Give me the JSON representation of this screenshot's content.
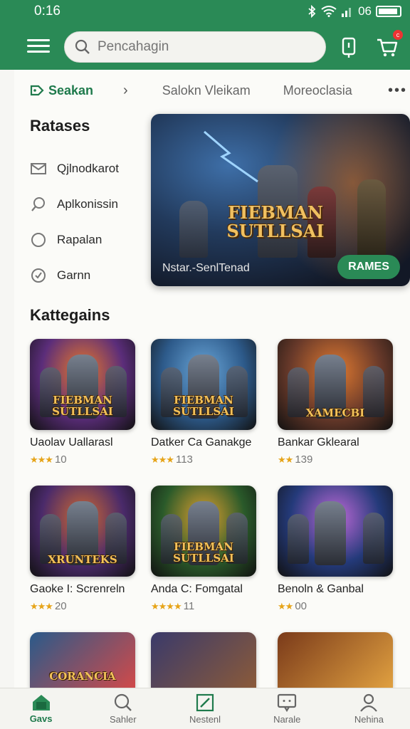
{
  "status": {
    "time": "0:16",
    "battery": "06"
  },
  "header": {
    "search_placeholder": "Pencahagin",
    "cart_badge": "c"
  },
  "breadcrumb": {
    "active": "Seakan",
    "link2": "Salokn Vleikam",
    "link3": "Moreoclasia",
    "more": "•••"
  },
  "sidebar": {
    "title": "Ratases",
    "items": [
      {
        "label": "Qjlnodkarot",
        "icon": "mail-icon"
      },
      {
        "label": "Aplkonissin",
        "icon": "search-icon"
      },
      {
        "label": "Rapalan",
        "icon": "circle-icon"
      },
      {
        "label": "Garnn",
        "icon": "check-circle-icon"
      }
    ]
  },
  "hero": {
    "logo_line1": "FIEBMAN",
    "logo_line2": "SUTLLSAI",
    "caption": "Nstar.-SenlTenad",
    "cta": "RAMES"
  },
  "categories": {
    "title": "Kattegains",
    "items": [
      {
        "name": "Uaolav Uallarasl",
        "rating": "10",
        "stars": "★★★",
        "logo": "FIEBMAN SUTLLSAI",
        "bg": "#5b2d7a",
        "accent": "#e8782a"
      },
      {
        "name": "Datker Ca Ganakge",
        "rating": "113",
        "stars": "★★★",
        "logo": "FIEBMAN SUTLLSAI",
        "bg": "#2d5a8a",
        "accent": "#6aa6d8"
      },
      {
        "name": "Bankar Gklearal",
        "rating": "139",
        "stars": "★★",
        "logo": "XAMECBI",
        "bg": "#6a3a2a",
        "accent": "#e07a30"
      },
      {
        "name": "Gaoke I: Screnreln",
        "rating": "20",
        "stars": "★★★",
        "logo": "XRUNTEKS",
        "bg": "#4a2a6a",
        "accent": "#d06a30"
      },
      {
        "name": "Anda C: Fomgatal",
        "rating": "11",
        "stars": "★★★★",
        "logo": "FIEBMAN SUTLLSAI",
        "bg": "#2a5a2a",
        "accent": "#e0a030"
      },
      {
        "name": "Benoln & Ganbal",
        "rating": "00",
        "stars": "★★",
        "logo": "",
        "bg": "#243a7a",
        "accent": "#c06ad8"
      }
    ],
    "partial_logo": "CORANCIA"
  },
  "bottom_nav": [
    {
      "label": "Gavs",
      "icon": "home-icon"
    },
    {
      "label": "Sahler",
      "icon": "search-icon"
    },
    {
      "label": "Nestenl",
      "icon": "edit-icon"
    },
    {
      "label": "Narale",
      "icon": "message-icon"
    },
    {
      "label": "Nehina",
      "icon": "profile-icon"
    }
  ],
  "colors": {
    "brand": "#2a8a56",
    "star": "#e6a419"
  }
}
